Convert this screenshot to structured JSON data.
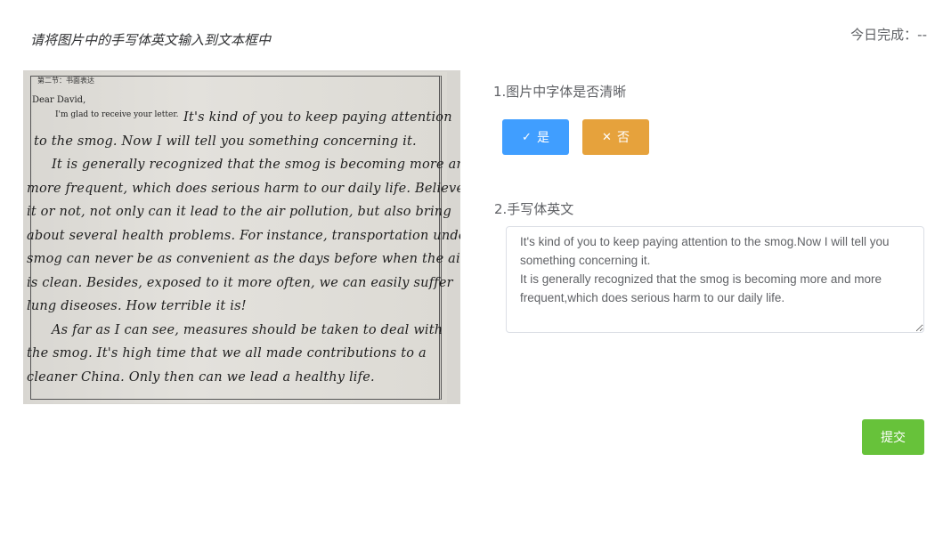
{
  "header": {
    "instruction": "请将图片中的手写体英文输入到文本框中",
    "today_label": "今日完成：--"
  },
  "image": {
    "heading": "第二节：书面表达",
    "greeting": "Dear David,",
    "printed_start": "I'm glad to receive your letter.",
    "handwriting_lines": [
      "It's kind of you to keep paying attention",
      "to the smog. Now I will tell you something concerning it.",
      "It is generally recognized that the smog is becoming more and",
      "more frequent, which does serious harm to our daily life. Believe",
      "it or not, not only can it lead to the air pollution, but also bring",
      "about several health problems. For instance, transportation under",
      "smog can never be as convenient as the days before when the air",
      "is clean. Besides, exposed to it more often, we can easily suffer",
      "lung diseoses. How terrible it is!",
      "As far as I can see, measures should be taken to deal with",
      "the smog. It's high time that we all made contributions to a",
      "cleaner China. Only then can we lead a healthy life."
    ]
  },
  "question1": {
    "label": "1.图片中字体是否清晰",
    "yes_label": "是",
    "no_label": "否",
    "yes_icon": "check-icon",
    "no_icon": "close-icon"
  },
  "question2": {
    "label": "2.手写体英文",
    "answer_value": "It's kind of you to keep paying attention to the smog.Now I will tell you something concerning it.\nIt is generally recognized that the smog is becoming more and more frequent,which does serious harm to our daily life."
  },
  "submit_label": "提交",
  "colors": {
    "primary": "#409eff",
    "warning": "#e6a23c",
    "success": "#67c23a",
    "text": "#606266"
  }
}
